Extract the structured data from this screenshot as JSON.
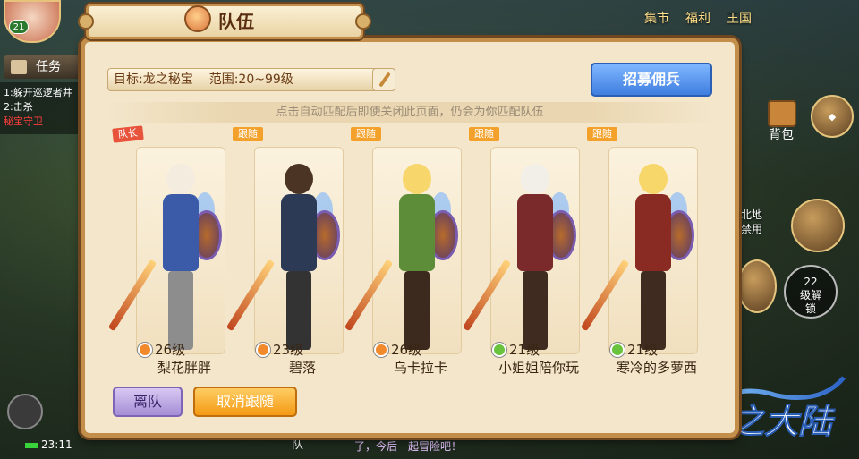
{
  "hud": {
    "avatar_level": "21",
    "quest_tab": "任务",
    "quests": [
      {
        "prefix": "1:躲开巡逻者井",
        "highlight": ""
      },
      {
        "prefix": "2:击杀",
        "highlight": "秘宝守卫"
      }
    ],
    "top_menu": [
      "集市",
      "福利",
      "王国"
    ],
    "bag_label": "背包",
    "partial_label": "北地\n禁用",
    "unlock_text": "22\n级解\n锁",
    "time": "23:11",
    "chat_prefix": "队",
    "chat_text": "了，今后一起冒险吧！"
  },
  "panel": {
    "title": "队伍",
    "target_label": "目标:龙之秘宝",
    "range_label": "范围:20~99级",
    "recruit_button": "招募佣兵",
    "hint": "点击自动匹配后即使关闭此页面，仍会为你匹配队伍",
    "members": [
      {
        "tag": "队长",
        "tag_type": "leader",
        "level": "26级",
        "name": "梨花胖胖",
        "level_icon": "up-arrow-icon",
        "palette": {
          "hair": "#f5ece0",
          "body": "#3b5aa8",
          "legs": "#8d8d8d"
        }
      },
      {
        "tag": "跟随",
        "tag_type": "follow",
        "level": "23级",
        "name": "碧落",
        "level_icon": "up-arrow-icon",
        "palette": {
          "hair": "#4b3423",
          "body": "#2c3a55",
          "legs": "#333333"
        }
      },
      {
        "tag": "跟随",
        "tag_type": "follow",
        "level": "26级",
        "name": "乌卡拉卡",
        "level_icon": "up-arrow-icon",
        "palette": {
          "hair": "#f7d66b",
          "body": "#5e8d3a",
          "legs": "#3d2a1e"
        }
      },
      {
        "tag": "跟随",
        "tag_type": "follow",
        "level": "21级",
        "name": "小姐姐陪你玩",
        "level_icon": "plus-icon",
        "palette": {
          "hair": "#f2efe9",
          "body": "#7a2a2a",
          "legs": "#3f2b20"
        }
      },
      {
        "tag": "跟随",
        "tag_type": "follow",
        "level": "21级",
        "name": "寒冷的多萝西",
        "level_icon": "plus-icon",
        "palette": {
          "hair": "#f7d76a",
          "body": "#8a2b23",
          "legs": "#3f2b20"
        }
      }
    ],
    "leave_button": "离队",
    "cancel_follow_button": "取消跟随"
  },
  "logo_text": "风之大陆"
}
